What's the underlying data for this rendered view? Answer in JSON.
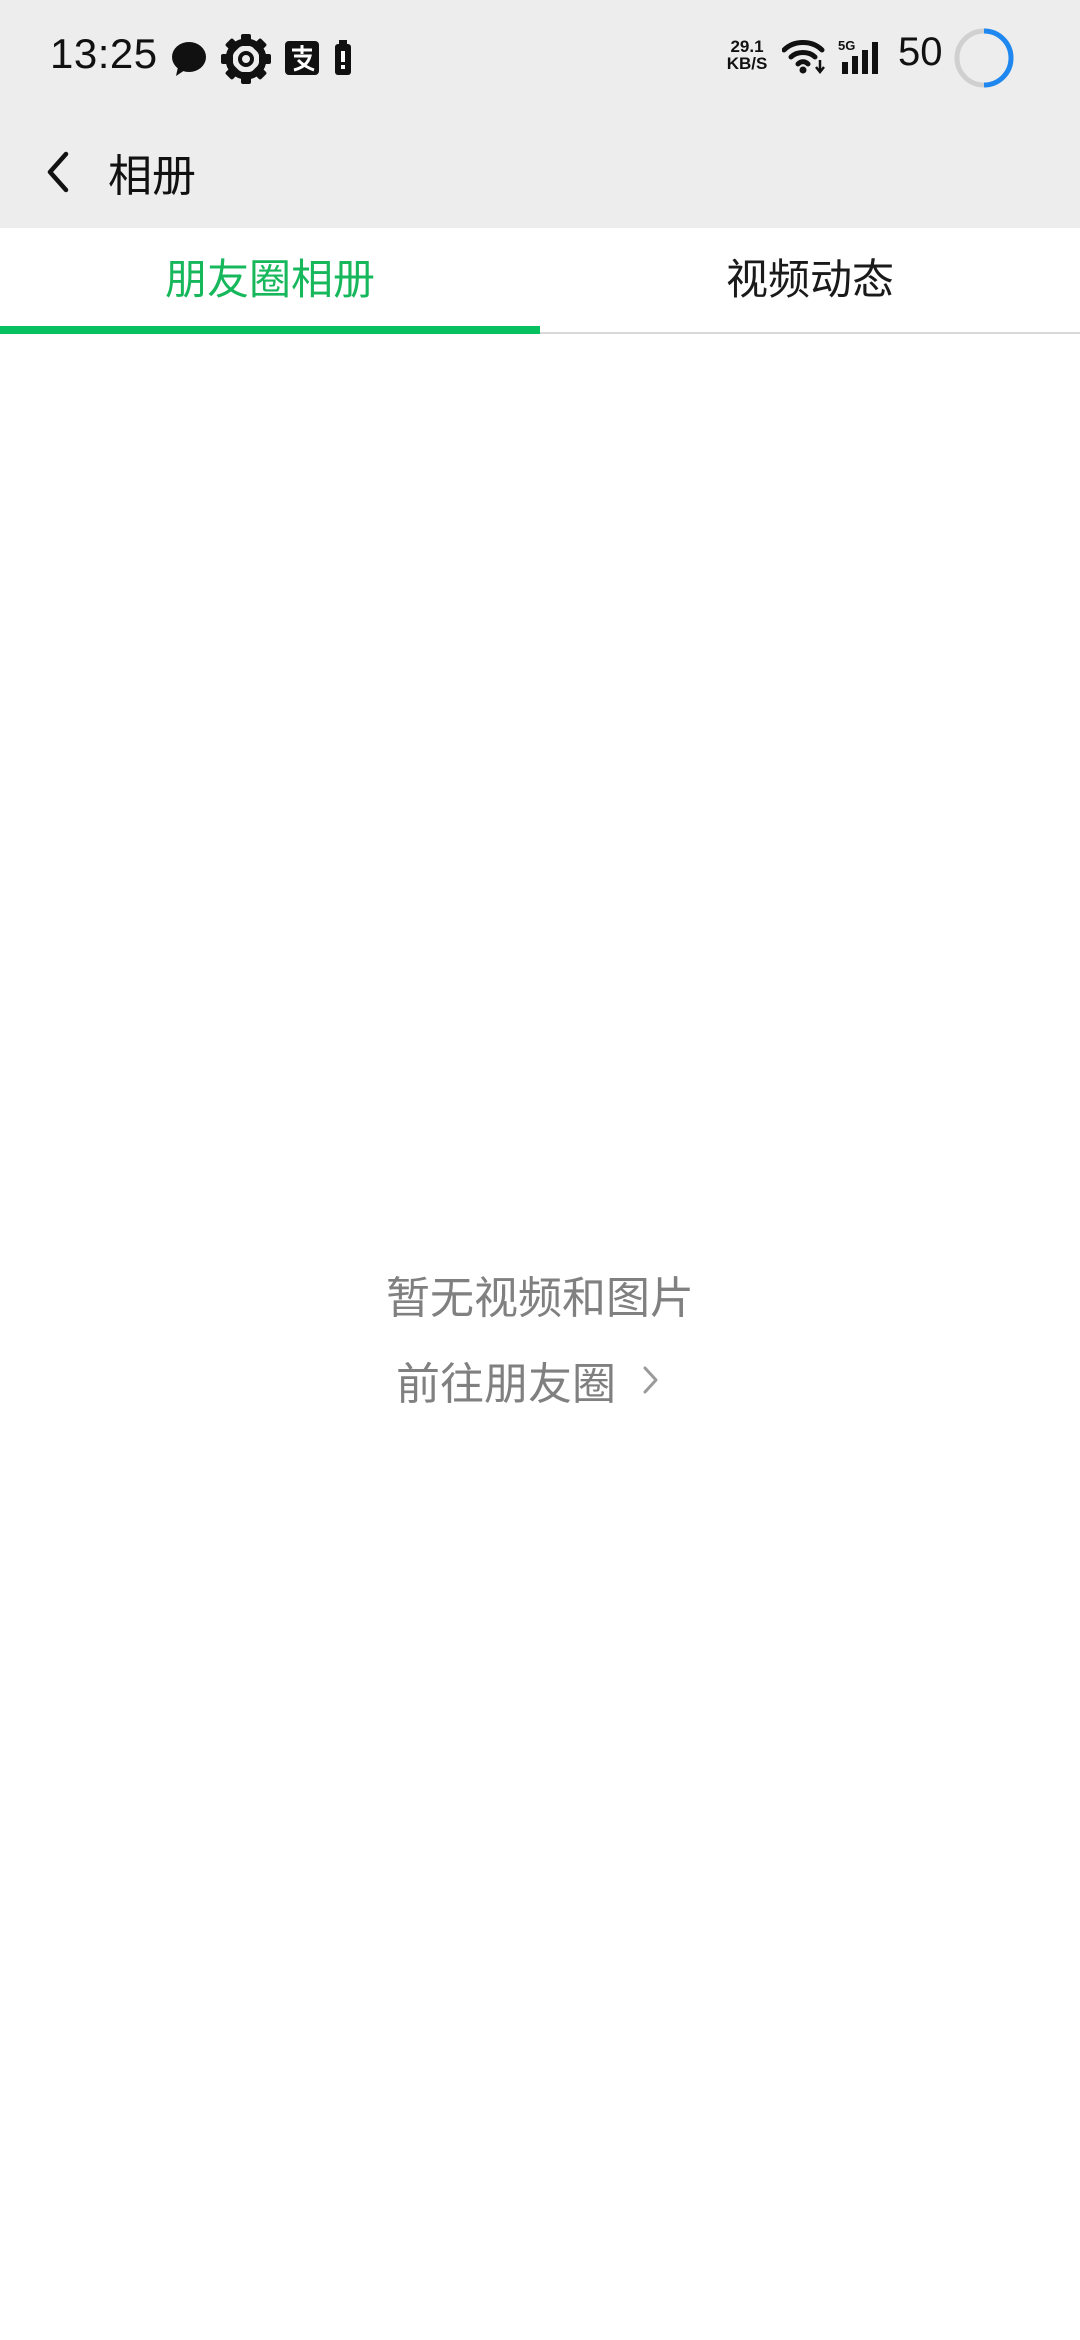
{
  "status_bar": {
    "time": "13:25",
    "net_speed_value": "29.1",
    "net_speed_unit": "KB/S",
    "network_type": "5G",
    "battery_level": "50",
    "icons": [
      "chat-bubble-icon",
      "gear-icon",
      "alipay-icon",
      "battery-small-icon",
      "wifi-icon",
      "signal-icon",
      "battery-ring-icon"
    ],
    "accent_color": "#1e88f0"
  },
  "header": {
    "title": "相册",
    "back_icon": "chevron-left-icon"
  },
  "tabs": [
    {
      "label": "朋友圈相册",
      "active": true
    },
    {
      "label": "视频动态",
      "active": false
    }
  ],
  "colors": {
    "active_tab": "#17b85c",
    "indicator": "#07c160",
    "muted_text": "#808080"
  },
  "empty_state": {
    "message": "暂无视频和图片",
    "link_label": "前往朋友圈",
    "link_icon": "chevron-right-icon"
  }
}
